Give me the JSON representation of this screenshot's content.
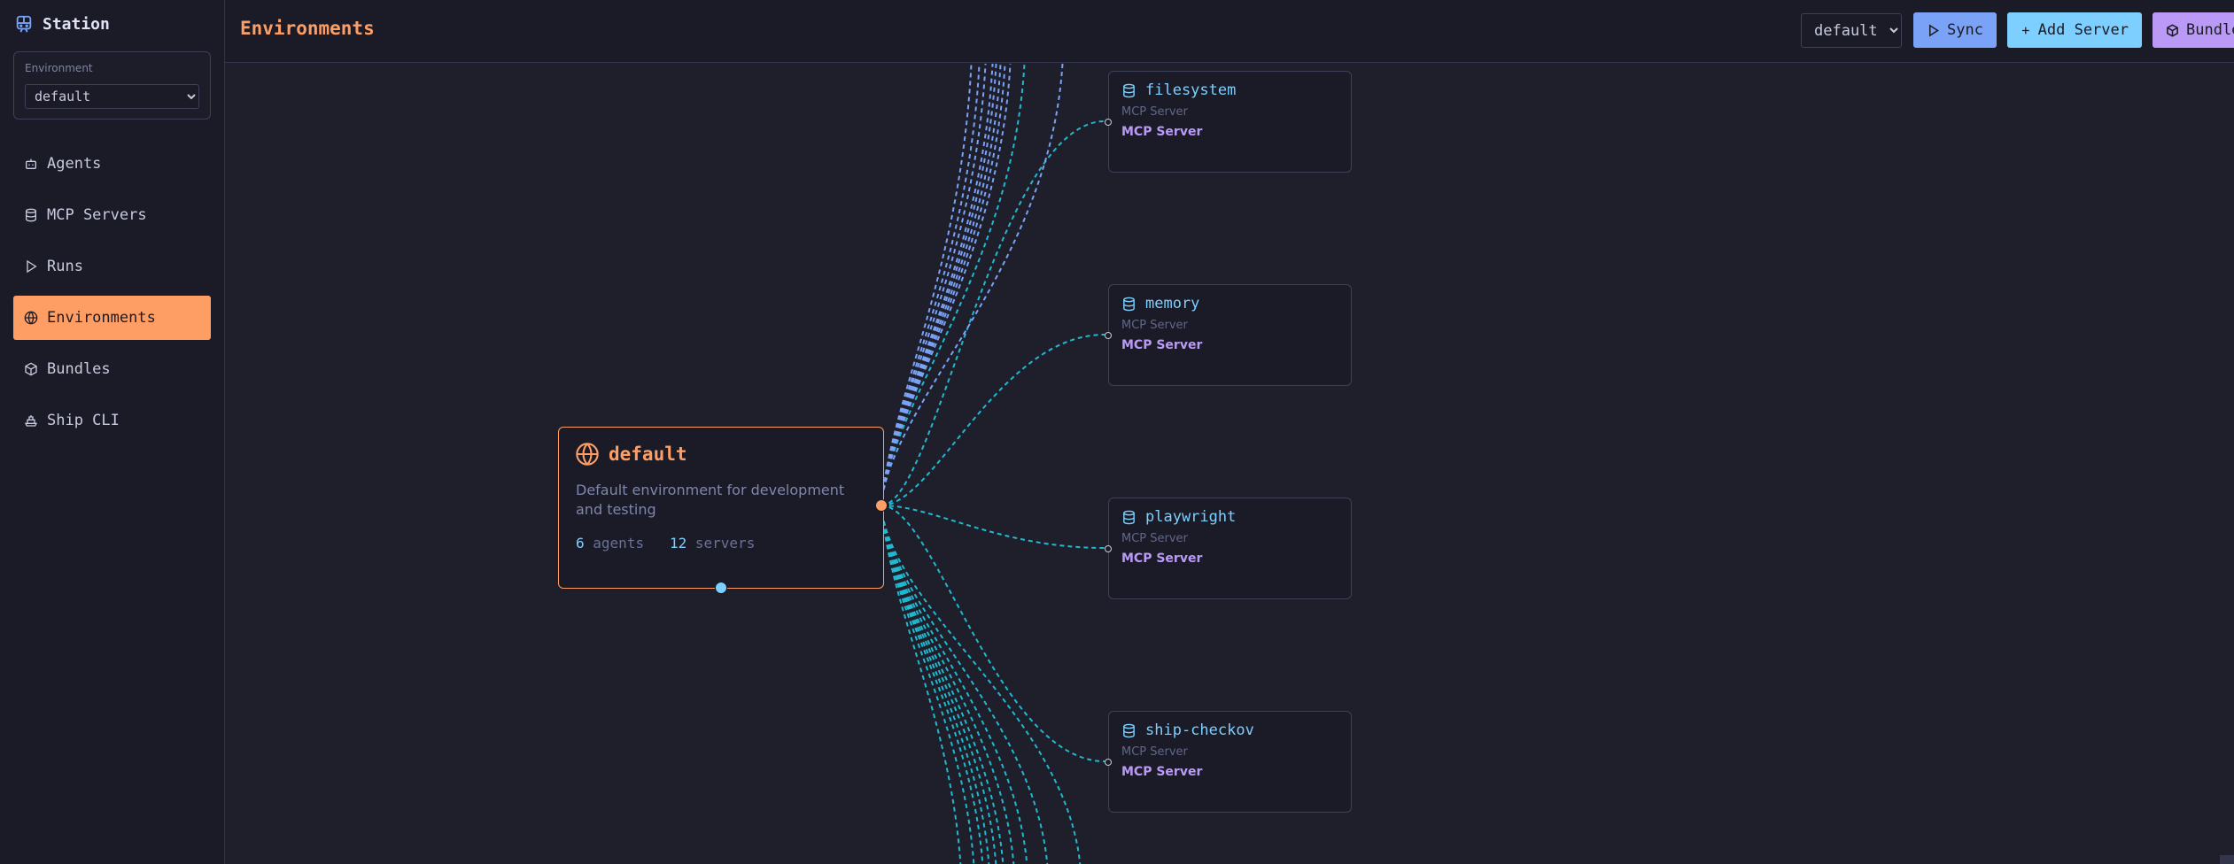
{
  "sidebar": {
    "brand": "Station",
    "environment_label": "Environment",
    "environment_value": "default",
    "items": [
      {
        "label": "Agents",
        "icon": "bot-icon"
      },
      {
        "label": "MCP Servers",
        "icon": "database-icon"
      },
      {
        "label": "Runs",
        "icon": "play-icon"
      },
      {
        "label": "Environments",
        "icon": "globe-icon",
        "active": true
      },
      {
        "label": "Bundles",
        "icon": "package-icon"
      },
      {
        "label": "Ship CLI",
        "icon": "ship-icon"
      }
    ]
  },
  "header": {
    "title": "Environments",
    "select_value": "default",
    "sync_label": "Sync",
    "add_server_label": "Add Server",
    "bundle_label": "Bundle"
  },
  "canvas": {
    "environment": {
      "name": "default",
      "description": "Default environment for development and testing",
      "agents_count": "6",
      "agents_label": "agents",
      "servers_count": "12",
      "servers_label": "servers"
    },
    "servers": [
      {
        "name": "filesystem",
        "subtitle": "MCP Server",
        "type": "MCP Server"
      },
      {
        "name": "memory",
        "subtitle": "MCP Server",
        "type": "MCP Server"
      },
      {
        "name": "playwright",
        "subtitle": "MCP Server",
        "type": "MCP Server"
      },
      {
        "name": "ship-checkov",
        "subtitle": "MCP Server",
        "type": "MCP Server"
      }
    ]
  },
  "colors": {
    "accent": "#ff9e64",
    "blue": "#7aa2f7",
    "cyan": "#7dcfff",
    "purple": "#bb9af7",
    "edge_agents": "#7aa2f7",
    "edge_servers": "#22b8cf"
  }
}
